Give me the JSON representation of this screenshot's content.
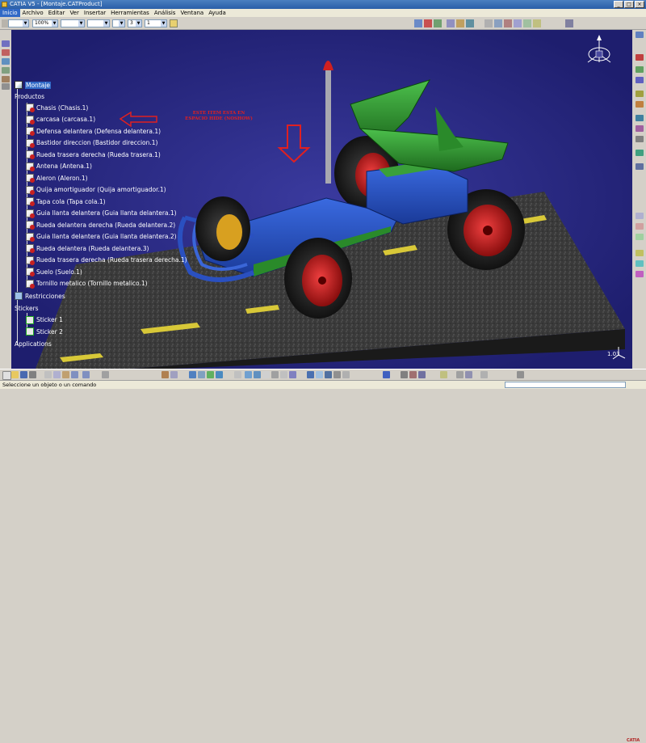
{
  "window": {
    "title": "CATIA V5 - [Montaje.CATProduct]",
    "buttons": [
      "_",
      "□",
      "×"
    ]
  },
  "menu": [
    "Inicio",
    "Archivo",
    "Editar",
    "Ver",
    "Insertar",
    "Herramientas",
    "Análisis",
    "Ventana",
    "Ayuda"
  ],
  "toolbar": {
    "zoom_value": "100%",
    "line_value": "3",
    "point_value": "1"
  },
  "tree": {
    "root": "Montaje",
    "productos_label": "Productos",
    "items": [
      "Chasis (Chasis.1)",
      "carcasa (carcasa.1)",
      "Defensa delantera (Defensa delantera.1)",
      "Bastidor direccion (Bastidor direccion.1)",
      "Rueda trasera derecha (Rueda trasera.1)",
      "Antena (Antena.1)",
      "Aleron (Aleron.1)",
      "Quija amortiguador (Quija amortiguador.1)",
      "Tapa cola (Tapa cola.1)",
      "Guia llanta delantera (Guia llanta delantera.1)",
      "Rueda delantera derecha (Rueda delantera.2)",
      "Guia llanta delantera (Guia llanta delantera.2)",
      "Rueda delantera (Rueda delantera.3)",
      "Rueda trasera derecha (Rueda trasera derecha.1)",
      "Suelo (Suelo.1)",
      "Tornillo metalico (Tornillo metalico.1)"
    ],
    "restricciones_label": "Restricciones",
    "stickers_label": "Stickers",
    "stickers": [
      "Sticker 1",
      "Sticker 2"
    ],
    "applications_label": "Applications"
  },
  "annotation": {
    "line1": "ESTE ITEM ESTA EN",
    "line2": "ESPACIO HIDE (NOSHOW)"
  },
  "viewport": {
    "zoom_label": "1.03"
  },
  "status": {
    "message": "Seleccione un objeto o un comando"
  },
  "logo": "CATIA",
  "colors": {
    "background": "#2d2d8a",
    "annotation": "#e02020",
    "road": "#3a3a3a",
    "body": "#2456c8",
    "spoiler": "#2c8a2c",
    "wheel_rim": "#c81e1e"
  }
}
